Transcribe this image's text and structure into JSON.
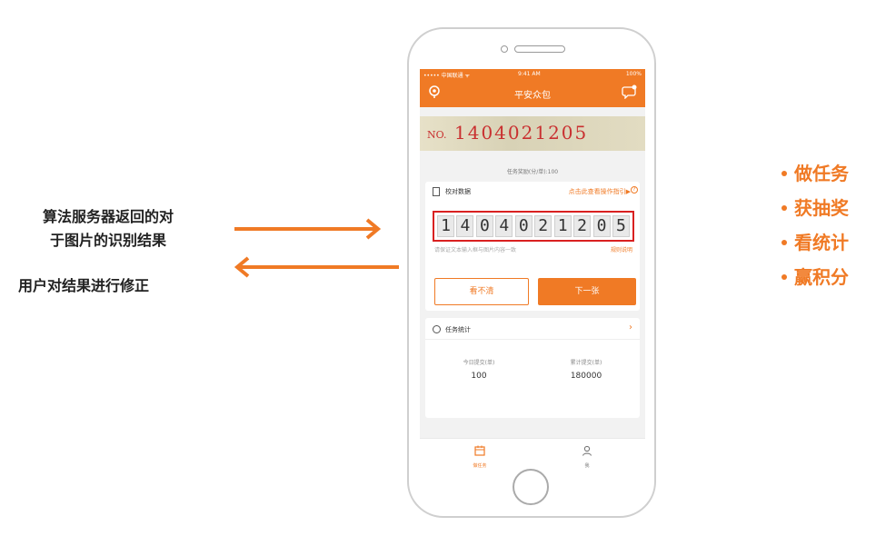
{
  "annotations": {
    "algo_line1": "算法服务器返回的对",
    "algo_line2": "于图片的识别结果",
    "user_fix": "用户对结果进行修正"
  },
  "features": [
    "做任务",
    "获抽奖",
    "看统计",
    "赢积分"
  ],
  "phone": {
    "status": {
      "carrier": "••••• 中国联通 ᯤ",
      "time": "9:41 AM",
      "battery": "100%"
    },
    "nav_title": "平安众包",
    "image_prefix": "NO.",
    "image_number": "1404021205",
    "reward": "任务奖励(分/单):100",
    "check_title": "校对数据",
    "guide_link": "点击此查看操作指引▶",
    "help_mark": "?",
    "digits": [
      "1",
      "4",
      "0",
      "4",
      "0",
      "2",
      "1",
      "2",
      "0",
      "5"
    ],
    "hint": "请保证文本输入框与图片内容一致",
    "rules": "规则说明",
    "btn_unclear": "看不清",
    "btn_next": "下一张",
    "stats_title": "任务统计",
    "chevron": "›",
    "today_label": "今日提交(单)",
    "today_value": "100",
    "total_label": "累计提交(单)",
    "total_value": "180000",
    "tab_task": "做任务",
    "tab_me": "我"
  },
  "colors": {
    "accent": "#f07a25",
    "highlight_border": "#d92020"
  }
}
